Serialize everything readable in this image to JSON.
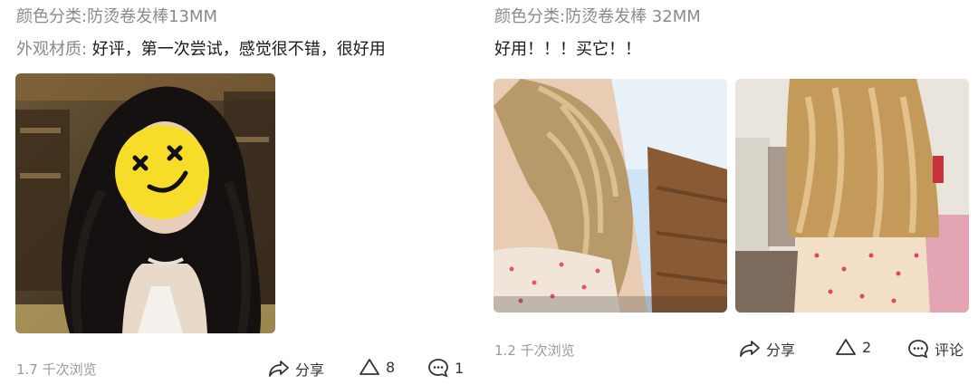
{
  "reviews": [
    {
      "variant": "颜色分类:防烫卷发棒13MM",
      "review_label": "外观材质:",
      "review_text": " 好评，第一次尝试，感觉很不错，很好用",
      "views": "1.7 千次浏览",
      "share_label": "分享",
      "like_count": "8",
      "comment_count": "1",
      "photos": [
        "woman-wavy-dark-hair-emoji-face-photo"
      ]
    },
    {
      "variant": "颜色分类:防烫卷发棒 32MM",
      "review_text": "好用！！！买它！！",
      "views": "1.2 千次浏览",
      "share_label": "分享",
      "like_count": "2",
      "comment_label": "评论",
      "photos": [
        "blonde-curly-hair-selfie-photo",
        "blonde-curly-hair-back-view-photo"
      ]
    }
  ],
  "icons": {
    "share": "share-arrow-icon",
    "like": "triangle-like-icon",
    "comment": "speech-bubble-comment-icon"
  },
  "colors": {
    "muted_text": "#8a8a8a",
    "body_text": "#1a1a1a",
    "emoji_yellow": "#f7dd2a"
  }
}
